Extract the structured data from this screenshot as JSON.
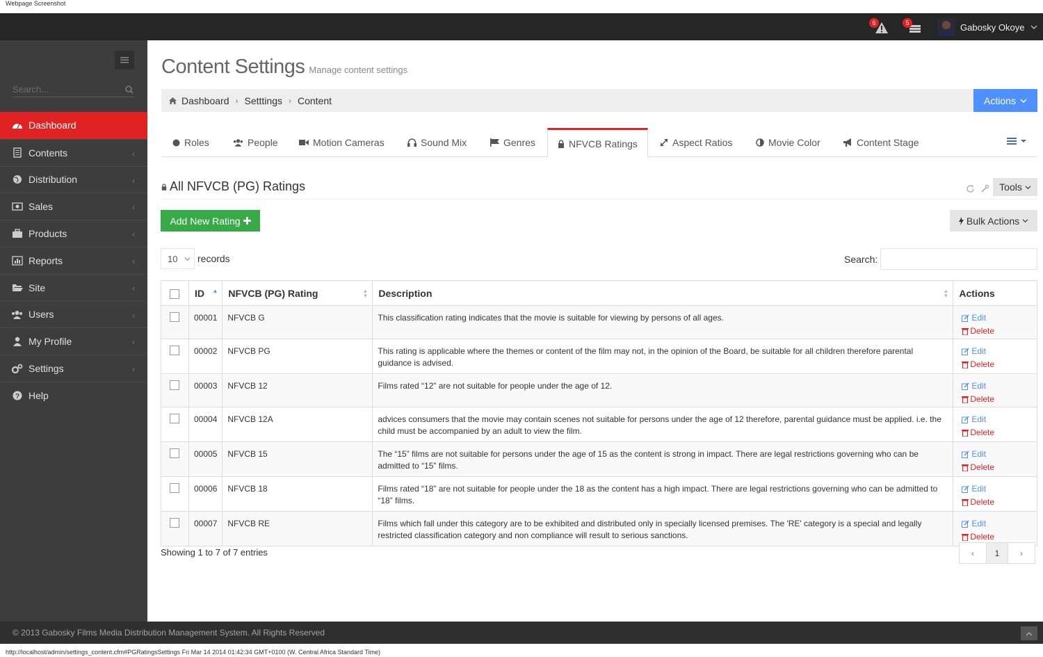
{
  "screenshot_label": "Webpage Screenshot",
  "topbar": {
    "notifications": [
      {
        "icon": "warning-icon",
        "count": "6"
      },
      {
        "icon": "inbox-icon",
        "count": "5"
      }
    ],
    "user_name": "Gabosky Okoye"
  },
  "sidebar": {
    "search_placeholder": "Search...",
    "items": [
      {
        "label": "Dashboard",
        "icon": "dashboard-icon",
        "active": true
      },
      {
        "label": "Contents",
        "icon": "file-icon"
      },
      {
        "label": "Distribution",
        "icon": "globe-icon"
      },
      {
        "label": "Sales",
        "icon": "money-icon"
      },
      {
        "label": "Products",
        "icon": "briefcase-icon"
      },
      {
        "label": "Reports",
        "icon": "bar-chart-icon"
      },
      {
        "label": "Site",
        "icon": "folder-open-icon"
      },
      {
        "label": "Users",
        "icon": "group-icon"
      },
      {
        "label": "My Profile",
        "icon": "user-icon"
      },
      {
        "label": "Settings",
        "icon": "cogs-icon"
      },
      {
        "label": "Help",
        "icon": "question-icon"
      }
    ]
  },
  "page": {
    "title": "Content Settings",
    "subtitle": "Manage content settings"
  },
  "breadcrumb": {
    "items": [
      "Dashboard",
      "Setttings",
      "Content"
    ],
    "actions_label": "Actions"
  },
  "tabs": [
    {
      "label": "Roles",
      "icon": "circle-icon"
    },
    {
      "label": "People",
      "icon": "group-icon"
    },
    {
      "label": "Motion Cameras",
      "icon": "video-camera-icon"
    },
    {
      "label": "Sound Mix",
      "icon": "headphones-icon"
    },
    {
      "label": "Genres",
      "icon": "flag-icon"
    },
    {
      "label": "NFVCB Ratings",
      "icon": "lock-icon",
      "active": true
    },
    {
      "label": "Aspect Ratios",
      "icon": "resize-icon"
    },
    {
      "label": "Movie Color",
      "icon": "adjust-icon"
    },
    {
      "label": "Content Stage",
      "icon": "bullhorn-icon"
    }
  ],
  "panel": {
    "title": "All NFVCB (PG) Ratings",
    "tools_label": "Tools",
    "add_label": "Add New Rating",
    "bulk_label": "Bulk Actions",
    "page_length": "10",
    "records_label": "records",
    "search_label": "Search:"
  },
  "table": {
    "headers": [
      "ID",
      "NFVCB (PG) Rating",
      "Description",
      "Actions"
    ],
    "edit_label": "Edit",
    "delete_label": "Delete",
    "rows": [
      {
        "id": "00001",
        "rating": "NFVCB G",
        "description": "This classification rating indicates that the movie is suitable for viewing by persons of all ages."
      },
      {
        "id": "00002",
        "rating": "NFVCB PG",
        "description": "This rating is applicable where the themes or content of the film may not, in the opinion of the Board, be suitable for all children therefore parental guidance is advised."
      },
      {
        "id": "00003",
        "rating": "NFVCB 12",
        "description": "Films rated “12” are not suitable for people under the age of 12."
      },
      {
        "id": "00004",
        "rating": "NFVCB 12A",
        "description": "advices consumers that the movie may contain scenes not suitable for persons under the age of 12 therefore, parental guidance must be applied. i.e. the child must be accompanied by an adult to view the film."
      },
      {
        "id": "00005",
        "rating": "NFVCB 15",
        "description": "The “15” films are not suitable for persons under the age of 15 as the content is strong in impact. There are legal restrictions governing who can be admitted to “15” films."
      },
      {
        "id": "00006",
        "rating": "NFVCB 18",
        "description": "Films rated “18” are not suitable for people under the 18 as the content has a high impact. There are legal restrictions governing who can be admitted to “18” films."
      },
      {
        "id": "00007",
        "rating": "NFVCB RE",
        "description": "Films which fall under this category are to be exhibited and distributed only in specially licensed premises. The 'RE' category is a special and legally restricted classification category and non compliance will result to serious sanctions."
      }
    ]
  },
  "pagination": {
    "info": "Showing 1 to 7 of 7 entries",
    "prev": "‹",
    "current": "1",
    "next": "›"
  },
  "footer": {
    "copyright": "© 2013 Gabosky Films Media Distribution Management System. All Rights Reserved"
  },
  "status_bar": "http://localhost/admin/settings_content.cfm#PGRatingsSettings Fri Mar 14 2014 01:42:34 GMT+0100 (W. Central Africa Standard Time)",
  "colors": {
    "accent_red": "#e02222",
    "primary_blue": "#4d90fe",
    "success_green": "#35aa47",
    "sidebar_bg": "#3d3d3d",
    "topbar_bg": "#262626"
  }
}
